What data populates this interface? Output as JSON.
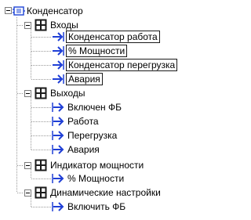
{
  "tree": {
    "root": {
      "label": "Конденсатор",
      "icon": "function-block-icon"
    },
    "groups": [
      {
        "label": "Входы",
        "icon": "folder-grid-icon",
        "items": [
          {
            "label": "Конденсатор работа",
            "icon": "input-arrow-icon"
          },
          {
            "label": "% Мощности",
            "icon": "input-arrow-icon"
          },
          {
            "label": "Конденсатор перегрузка",
            "icon": "input-arrow-icon"
          },
          {
            "label": "Авария",
            "icon": "input-arrow-icon"
          }
        ]
      },
      {
        "label": "Выходы",
        "icon": "folder-grid-icon",
        "items": [
          {
            "label": "Включен ФБ",
            "icon": "output-arrow-icon"
          },
          {
            "label": "Работа",
            "icon": "output-arrow-icon"
          },
          {
            "label": "Перегрузка",
            "icon": "output-arrow-icon"
          },
          {
            "label": "Авария",
            "icon": "output-arrow-icon"
          }
        ]
      },
      {
        "label": "Индикатор мощности",
        "icon": "folder-grid-icon",
        "items": [
          {
            "label": "% Мощности",
            "icon": "output-arrow-icon"
          }
        ]
      },
      {
        "label": "Динамические настройки",
        "icon": "folder-grid-icon",
        "items": [
          {
            "label": "Включить ФБ",
            "icon": "output-arrow-icon"
          }
        ]
      }
    ]
  },
  "colors": {
    "arrow_blue": "#1f3fd6",
    "folder_dark": "#1a1a1a",
    "root_icon_blue": "#2a4fd8",
    "tree_lines": "#9a9a9a"
  }
}
